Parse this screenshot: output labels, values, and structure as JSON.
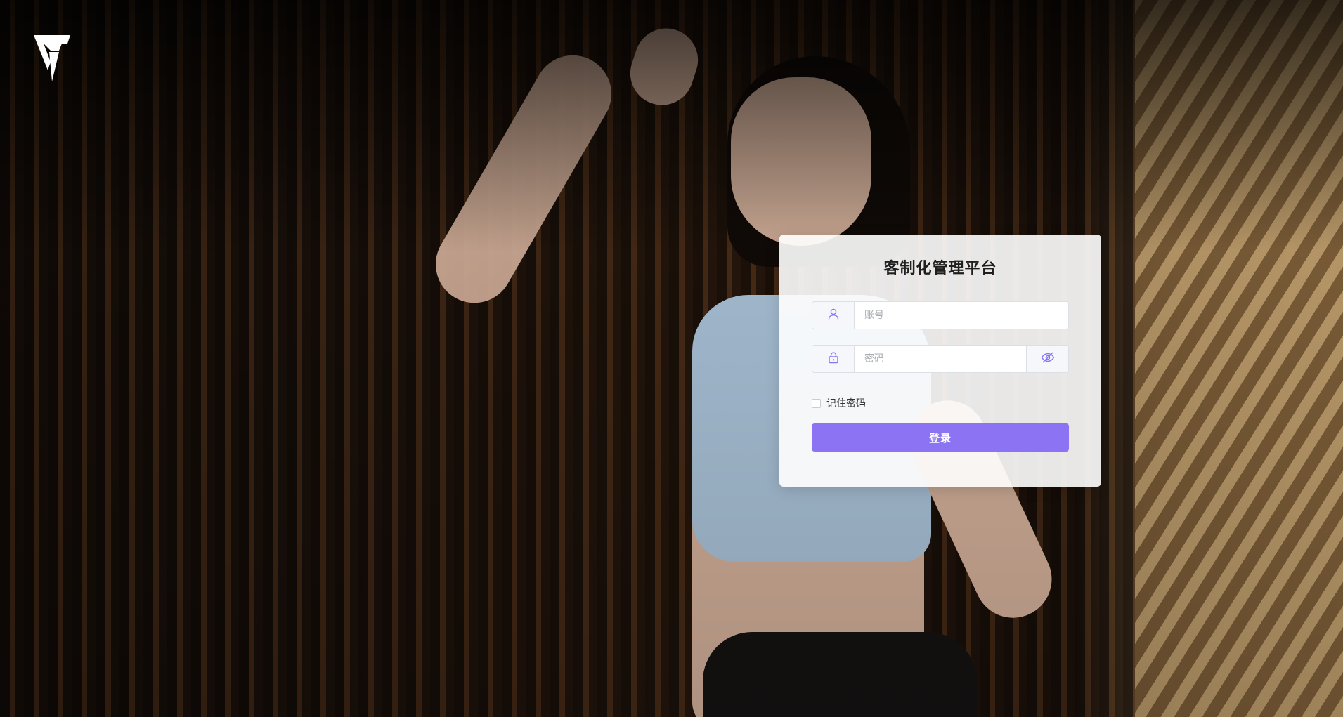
{
  "colors": {
    "accent": "#8b73f3",
    "card_bg": "#ffffff",
    "icon": "#8b73f3",
    "addon_bg": "#f5f7fa"
  },
  "logo": {
    "icon": "brand-logo-icon"
  },
  "login": {
    "title": "客制化管理平台",
    "account": {
      "icon": "user-icon",
      "placeholder": "账号",
      "value": ""
    },
    "password": {
      "icon": "lock-icon",
      "placeholder": "密码",
      "value": "",
      "toggle_icon": "eye-hidden-icon"
    },
    "remember_label": "记住密码",
    "remember_checked": false,
    "submit_label": "登录"
  }
}
